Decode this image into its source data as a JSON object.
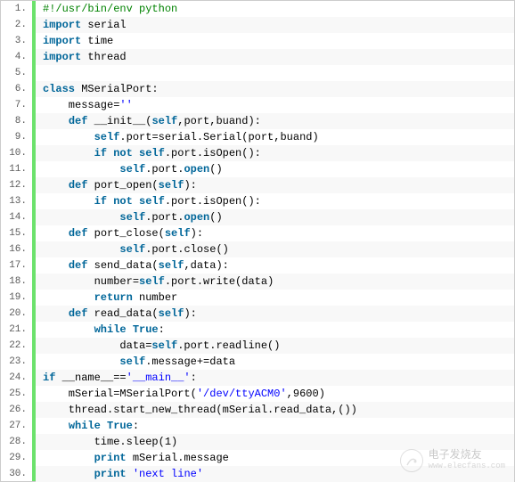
{
  "lines": [
    {
      "n": "1.",
      "tokens": [
        {
          "cls": "comment",
          "t": "#!/usr/bin/env python"
        }
      ]
    },
    {
      "n": "2.",
      "tokens": [
        {
          "cls": "kw",
          "t": "import"
        },
        {
          "cls": "plain",
          "t": " serial"
        }
      ]
    },
    {
      "n": "3.",
      "tokens": [
        {
          "cls": "kw",
          "t": "import"
        },
        {
          "cls": "plain",
          "t": " time"
        }
      ]
    },
    {
      "n": "4.",
      "tokens": [
        {
          "cls": "kw",
          "t": "import"
        },
        {
          "cls": "plain",
          "t": " thread"
        }
      ]
    },
    {
      "n": "5.",
      "tokens": []
    },
    {
      "n": "6.",
      "tokens": [
        {
          "cls": "kw",
          "t": "class"
        },
        {
          "cls": "plain",
          "t": " MSerialPort:"
        }
      ]
    },
    {
      "n": "7.",
      "tokens": [
        {
          "cls": "plain",
          "t": "    message="
        },
        {
          "cls": "string",
          "t": "''"
        }
      ]
    },
    {
      "n": "8.",
      "tokens": [
        {
          "cls": "plain",
          "t": "    "
        },
        {
          "cls": "kw",
          "t": "def"
        },
        {
          "cls": "plain",
          "t": " __init__("
        },
        {
          "cls": "kw",
          "t": "self"
        },
        {
          "cls": "plain",
          "t": ",port,buand):"
        }
      ]
    },
    {
      "n": "9.",
      "tokens": [
        {
          "cls": "plain",
          "t": "        "
        },
        {
          "cls": "kw",
          "t": "self"
        },
        {
          "cls": "plain",
          "t": ".port"
        },
        {
          "cls": "plain",
          "t": "="
        },
        {
          "cls": "plain",
          "t": "serial.Serial(port,buand)"
        }
      ]
    },
    {
      "n": "10.",
      "tokens": [
        {
          "cls": "plain",
          "t": "        "
        },
        {
          "cls": "kw",
          "t": "if"
        },
        {
          "cls": "plain",
          "t": " "
        },
        {
          "cls": "kw",
          "t": "not"
        },
        {
          "cls": "plain",
          "t": " "
        },
        {
          "cls": "kw",
          "t": "self"
        },
        {
          "cls": "plain",
          "t": ".port.isOpen():"
        }
      ]
    },
    {
      "n": "11.",
      "tokens": [
        {
          "cls": "plain",
          "t": "            "
        },
        {
          "cls": "kw",
          "t": "self"
        },
        {
          "cls": "plain",
          "t": ".port."
        },
        {
          "cls": "kw",
          "t": "open"
        },
        {
          "cls": "plain",
          "t": "()"
        }
      ]
    },
    {
      "n": "12.",
      "tokens": [
        {
          "cls": "plain",
          "t": "    "
        },
        {
          "cls": "kw",
          "t": "def"
        },
        {
          "cls": "plain",
          "t": " port_open("
        },
        {
          "cls": "kw",
          "t": "self"
        },
        {
          "cls": "plain",
          "t": "):"
        }
      ]
    },
    {
      "n": "13.",
      "tokens": [
        {
          "cls": "plain",
          "t": "        "
        },
        {
          "cls": "kw",
          "t": "if"
        },
        {
          "cls": "plain",
          "t": " "
        },
        {
          "cls": "kw",
          "t": "not"
        },
        {
          "cls": "plain",
          "t": " "
        },
        {
          "cls": "kw",
          "t": "self"
        },
        {
          "cls": "plain",
          "t": ".port.isOpen():"
        }
      ]
    },
    {
      "n": "14.",
      "tokens": [
        {
          "cls": "plain",
          "t": "            "
        },
        {
          "cls": "kw",
          "t": "self"
        },
        {
          "cls": "plain",
          "t": ".port."
        },
        {
          "cls": "kw",
          "t": "open"
        },
        {
          "cls": "plain",
          "t": "()"
        }
      ]
    },
    {
      "n": "15.",
      "tokens": [
        {
          "cls": "plain",
          "t": "    "
        },
        {
          "cls": "kw",
          "t": "def"
        },
        {
          "cls": "plain",
          "t": " port_close("
        },
        {
          "cls": "kw",
          "t": "self"
        },
        {
          "cls": "plain",
          "t": "):"
        }
      ]
    },
    {
      "n": "16.",
      "tokens": [
        {
          "cls": "plain",
          "t": "            "
        },
        {
          "cls": "kw",
          "t": "self"
        },
        {
          "cls": "plain",
          "t": ".port.close()"
        }
      ]
    },
    {
      "n": "17.",
      "tokens": [
        {
          "cls": "plain",
          "t": "    "
        },
        {
          "cls": "kw",
          "t": "def"
        },
        {
          "cls": "plain",
          "t": " send_data("
        },
        {
          "cls": "kw",
          "t": "self"
        },
        {
          "cls": "plain",
          "t": ",data):"
        }
      ]
    },
    {
      "n": "18.",
      "tokens": [
        {
          "cls": "plain",
          "t": "        number"
        },
        {
          "cls": "plain",
          "t": "="
        },
        {
          "cls": "kw",
          "t": "self"
        },
        {
          "cls": "plain",
          "t": ".port.write(data)"
        }
      ]
    },
    {
      "n": "19.",
      "tokens": [
        {
          "cls": "plain",
          "t": "        "
        },
        {
          "cls": "kw",
          "t": "return"
        },
        {
          "cls": "plain",
          "t": " number"
        }
      ]
    },
    {
      "n": "20.",
      "tokens": [
        {
          "cls": "plain",
          "t": "    "
        },
        {
          "cls": "kw",
          "t": "def"
        },
        {
          "cls": "plain",
          "t": " read_data("
        },
        {
          "cls": "kw",
          "t": "self"
        },
        {
          "cls": "plain",
          "t": "):"
        }
      ]
    },
    {
      "n": "21.",
      "tokens": [
        {
          "cls": "plain",
          "t": "        "
        },
        {
          "cls": "kw",
          "t": "while"
        },
        {
          "cls": "plain",
          "t": " "
        },
        {
          "cls": "kw",
          "t": "True"
        },
        {
          "cls": "plain",
          "t": ":"
        }
      ]
    },
    {
      "n": "22.",
      "tokens": [
        {
          "cls": "plain",
          "t": "            data"
        },
        {
          "cls": "plain",
          "t": "="
        },
        {
          "cls": "kw",
          "t": "self"
        },
        {
          "cls": "plain",
          "t": ".port.readline()"
        }
      ]
    },
    {
      "n": "23.",
      "tokens": [
        {
          "cls": "plain",
          "t": "            "
        },
        {
          "cls": "kw",
          "t": "self"
        },
        {
          "cls": "plain",
          "t": ".message"
        },
        {
          "cls": "plain",
          "t": "+="
        },
        {
          "cls": "plain",
          "t": "data"
        }
      ]
    },
    {
      "n": "24.",
      "tokens": [
        {
          "cls": "kw",
          "t": "if"
        },
        {
          "cls": "plain",
          "t": " __name__"
        },
        {
          "cls": "plain",
          "t": "=="
        },
        {
          "cls": "string",
          "t": "'__main__'"
        },
        {
          "cls": "plain",
          "t": ":"
        }
      ]
    },
    {
      "n": "25.",
      "tokens": [
        {
          "cls": "plain",
          "t": "    mSerial"
        },
        {
          "cls": "plain",
          "t": "="
        },
        {
          "cls": "plain",
          "t": "MSerialPort("
        },
        {
          "cls": "string",
          "t": "'/dev/ttyACM0'"
        },
        {
          "cls": "plain",
          "t": ","
        },
        {
          "cls": "plain",
          "t": "9600"
        },
        {
          "cls": "plain",
          "t": ")"
        }
      ]
    },
    {
      "n": "26.",
      "tokens": [
        {
          "cls": "plain",
          "t": "    thread.start_new_thread(mSerial.read_data,())"
        }
      ]
    },
    {
      "n": "27.",
      "tokens": [
        {
          "cls": "plain",
          "t": "    "
        },
        {
          "cls": "kw",
          "t": "while"
        },
        {
          "cls": "plain",
          "t": " "
        },
        {
          "cls": "kw",
          "t": "True"
        },
        {
          "cls": "plain",
          "t": ":"
        }
      ]
    },
    {
      "n": "28.",
      "tokens": [
        {
          "cls": "plain",
          "t": "        time.sleep("
        },
        {
          "cls": "plain",
          "t": "1"
        },
        {
          "cls": "plain",
          "t": ")"
        }
      ]
    },
    {
      "n": "29.",
      "tokens": [
        {
          "cls": "plain",
          "t": "        "
        },
        {
          "cls": "kw",
          "t": "print"
        },
        {
          "cls": "plain",
          "t": " mSerial.message"
        }
      ]
    },
    {
      "n": "30.",
      "tokens": [
        {
          "cls": "plain",
          "t": "        "
        },
        {
          "cls": "kw",
          "t": "print"
        },
        {
          "cls": "plain",
          "t": " "
        },
        {
          "cls": "string",
          "t": "'next line'"
        }
      ]
    }
  ],
  "watermark": {
    "cn": "电子发烧友",
    "url": "www.elecfans.com"
  }
}
